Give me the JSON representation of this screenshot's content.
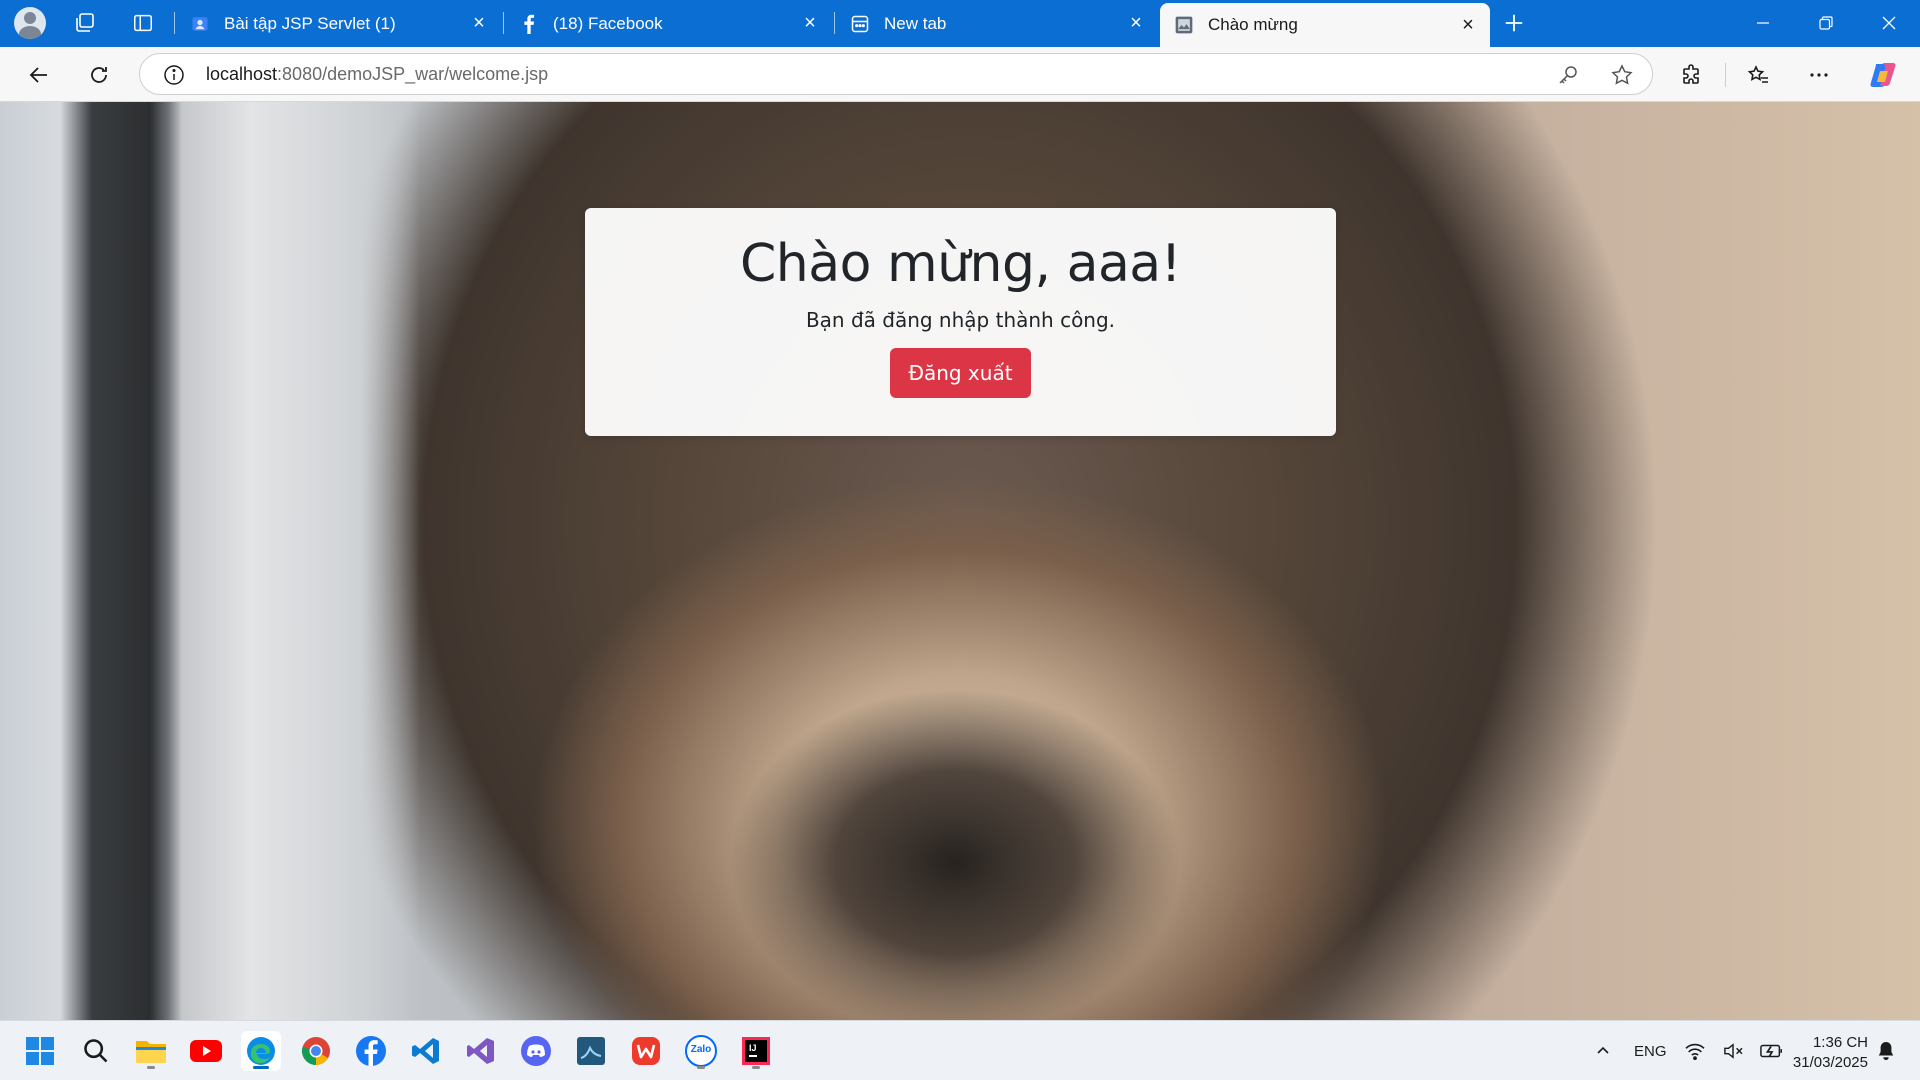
{
  "browser": {
    "tabs": [
      {
        "title": "Bài tập JSP Servlet (1)",
        "favicon": "person-card-icon",
        "active": false
      },
      {
        "title": "(18) Facebook",
        "favicon": "facebook-icon",
        "active": false
      },
      {
        "title": "New tab",
        "favicon": "new-tab-icon",
        "active": false
      },
      {
        "title": "Chào mừng",
        "favicon": "page-image-icon",
        "active": true
      }
    ],
    "address": {
      "host": "localhost",
      "rest": ":8080/demoJSP_war/welcome.jsp"
    }
  },
  "page": {
    "heading": "Chào mừng, aaa!",
    "message": "Bạn đã đăng nhập thành công.",
    "logout_label": "Đăng xuất"
  },
  "colors": {
    "tabstrip": "#0b6ed3",
    "logout_button": "#dc3545"
  },
  "taskbar": {
    "apps": [
      "windows-start-icon",
      "search-icon",
      "file-explorer-icon",
      "youtube-icon",
      "edge-icon",
      "chrome-icon",
      "facebook-icon",
      "vscode-icon",
      "visual-studio-icon",
      "discord-icon",
      "mysql-workbench-icon",
      "wps-office-icon",
      "zalo-icon",
      "intellij-icon"
    ],
    "zalo_label": "Zalo",
    "language": "ENG",
    "time": "1:36 CH",
    "date": "31/03/2025"
  }
}
